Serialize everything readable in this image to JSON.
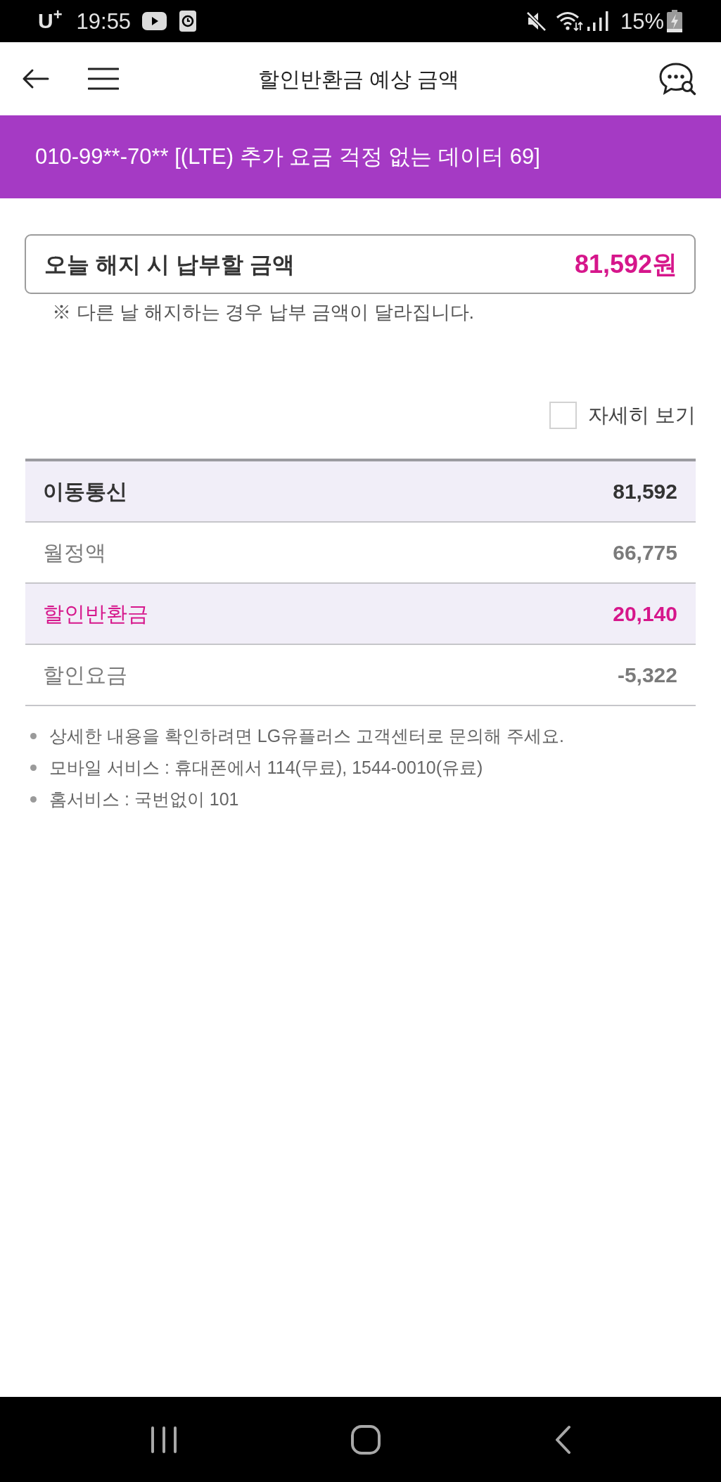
{
  "status_bar": {
    "carrier": "U$^{+}$",
    "time": "19:55",
    "battery": "15%"
  },
  "header": {
    "title": "할인반환금 예상 금액"
  },
  "plan_banner": {
    "text": "010-99**-70** [(LTE) 추가 요금 걱정 없는 데이터 69]"
  },
  "total": {
    "label": "오늘 해지 시 납부할 금액",
    "amount": "81,592원",
    "note": "※ 다른 날 해지하는 경우 납부 금액이 달라집니다."
  },
  "details_toggle": {
    "label": "자세히 보기",
    "checked": false
  },
  "breakdown": {
    "rows": [
      {
        "kind": "total",
        "label": "이동통신",
        "value": "81,592"
      },
      {
        "kind": "item",
        "label": "월정액",
        "value": "66,775"
      },
      {
        "kind": "highlight",
        "label": "할인반환금",
        "value": "20,140"
      },
      {
        "kind": "item",
        "label": "할인요금",
        "value": "-5,322"
      }
    ]
  },
  "notes": [
    "상세한 내용을 확인하려면 LG유플러스 고객센터로 문의해 주세요.",
    "모바일 서비스 : 휴대폰에서 114(무료), 1544-0010(유료)",
    "홈서비스 : 국번없이 101"
  ]
}
